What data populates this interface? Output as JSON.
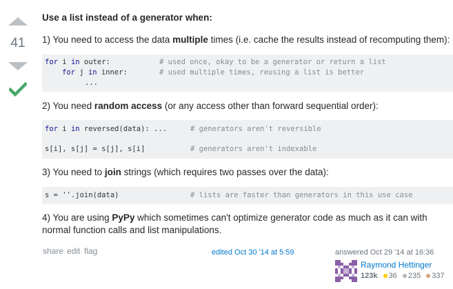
{
  "vote": {
    "score": "41"
  },
  "post": {
    "heading": "Use a list instead of a generator when:",
    "p1": {
      "before": "1) You need to access the data ",
      "bold": "multiple",
      "after": " times (i.e. cache the results instead of recomputing them):"
    },
    "code1": {
      "l1_code_a": "for",
      "l1_code_b": " i ",
      "l1_code_c": "in",
      "l1_code_d": " outer:",
      "l1_comment": "# used once, okay to be a generator or return a list",
      "l2_code_a": "for",
      "l2_code_b": " j ",
      "l2_code_c": "in",
      "l2_code_d": " inner:",
      "l2_comment": "# used multiple times, reusing a list is better",
      "l3_code": "..."
    },
    "p2": {
      "before": "2) You need ",
      "bold": "random access",
      "after": " (or any access other than forward sequential order):"
    },
    "code2": {
      "l1_code_a": "for",
      "l1_code_b": " i ",
      "l1_code_c": "in",
      "l1_code_d": " reversed(data): ...",
      "l1_comment": "# generators aren't reversible",
      "l2_code": "s[i], s[j] = s[j], s[i]",
      "l2_comment": "# generators aren't indexable"
    },
    "p3": {
      "before": "3) You need to ",
      "bold": "join",
      "after": " strings (which requires two passes over the data):"
    },
    "code3": {
      "l1_code": "s = ''.join(data)",
      "l1_comment": "# lists are faster than generators in this use case"
    },
    "p4": {
      "before": "4) You are using ",
      "bold": "PyPy",
      "after": " which sometimes can't optimize generator code as much as it can with",
      "line2": "normal function calls and list manipulations."
    }
  },
  "footer": {
    "share": "share",
    "edit": "edit",
    "flag": "flag",
    "edited": "edited Oct 30 '14 at 5:59",
    "answered": "answered Oct 29 '14 at 16:36",
    "user_name": "Raymond Hettinger",
    "reputation": "123k",
    "gold": "36",
    "silver": "235",
    "bronze": "337"
  },
  "colors": {
    "accept_check": "#48a868",
    "gold_badge": "#ffcc01",
    "silver_badge": "#b4b8bc",
    "bronze_badge": "#d1a684",
    "link": "#0077cc"
  }
}
